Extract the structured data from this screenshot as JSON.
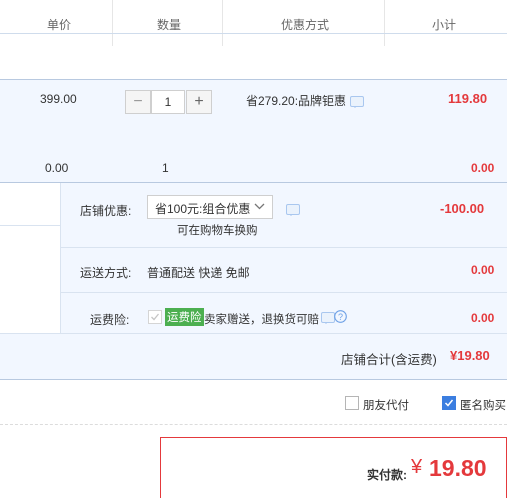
{
  "header": {
    "price": "单价",
    "qty": "数量",
    "discount": "优惠方式",
    "subtotal": "小计"
  },
  "item1": {
    "price": "399.00",
    "quantity": "1",
    "discount": "省279.20:品牌钜惠",
    "subtotal": "119.80"
  },
  "item2": {
    "price": "0.00",
    "quantity": "1",
    "subtotal": "0.00"
  },
  "shop_discount": {
    "label": "店铺优惠:",
    "selected": "省100元:组合优惠",
    "note": "可在购物车换购",
    "amount": "-100.00"
  },
  "shipping": {
    "label": "运送方式:",
    "value": "普通配送 快递 免邮",
    "amount": "0.00"
  },
  "insurance": {
    "label": "运费险:",
    "badge": "运费险",
    "text": "卖家赠送，退换货可赔",
    "amount": "0.00"
  },
  "shop_total": {
    "label": "店铺合计(含运费)",
    "amount": "¥19.80"
  },
  "options": {
    "friend_pay": "朋友代付",
    "anonymous": "匿名购买"
  },
  "payment": {
    "label": "实付款:",
    "currency": "¥",
    "amount": "19.80"
  },
  "colors": {
    "accent_red": "#e4393c",
    "light_blue": "#f2f7ff",
    "badge_green": "#4caf50"
  }
}
